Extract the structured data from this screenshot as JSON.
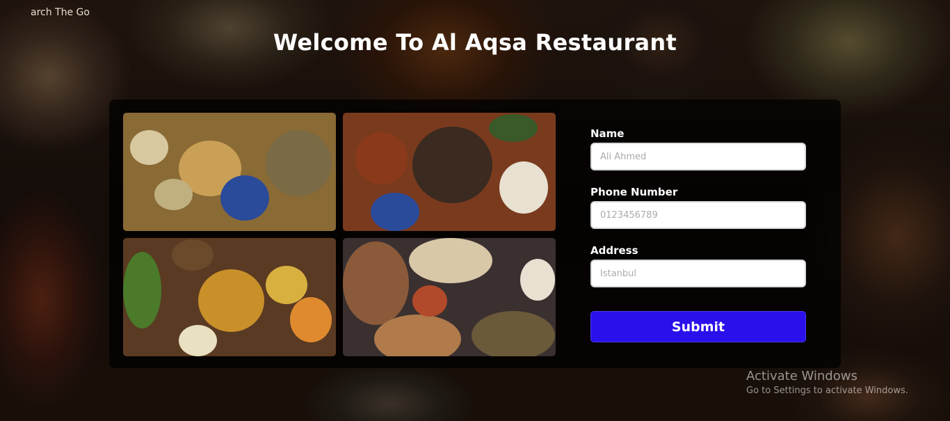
{
  "page": {
    "corner_text": "arch The Go",
    "title": "Welcome To Al Aqsa Restaurant"
  },
  "gallery": {
    "images": [
      {
        "name": "mezze-platter-image"
      },
      {
        "name": "stew-platter-image"
      },
      {
        "name": "rice-dishes-image"
      },
      {
        "name": "feast-spread-image"
      }
    ]
  },
  "form": {
    "name_label": "Name",
    "name_placeholder": "Ali Ahmed",
    "phone_label": "Phone Number",
    "phone_placeholder": "0123456789",
    "address_label": "Address",
    "address_placeholder": "Istanbul",
    "submit_label": "Submit"
  },
  "watermark": {
    "line1": "Activate Windows",
    "line2": "Go to Settings to activate Windows."
  },
  "colors": {
    "submit_bg": "#2a10ea",
    "panel_bg": "rgba(0,0,0,0.72)"
  }
}
